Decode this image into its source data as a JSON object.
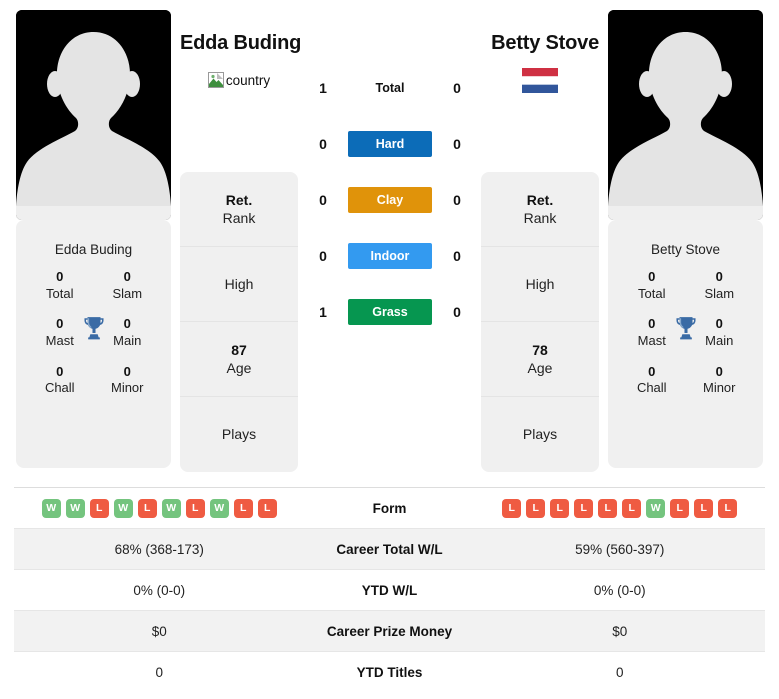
{
  "players": {
    "left": {
      "name": "Edda Buding",
      "card_name": "Edda Buding",
      "country_icon": "broken-image-icon",
      "country_alt": "country",
      "titles": [
        {
          "num": "0",
          "label": "Total"
        },
        {
          "num": "0",
          "label": "Slam"
        },
        {
          "num": "0",
          "label": "Mast"
        },
        {
          "num": "0",
          "label": "Main"
        },
        {
          "num": "0",
          "label": "Chall"
        },
        {
          "num": "0",
          "label": "Minor"
        }
      ],
      "trophy_icon": "trophy-icon",
      "info": [
        {
          "value": "Ret.",
          "label": "Rank"
        },
        {
          "value": "",
          "label": "High"
        },
        {
          "value": "87",
          "label": "Age"
        },
        {
          "value": "",
          "label": "Plays"
        }
      ]
    },
    "right": {
      "name": "Betty Stove",
      "card_name": "Betty Stove",
      "country_icon": "netherlands-flag-icon",
      "country_alt": "Netherlands",
      "titles": [
        {
          "num": "0",
          "label": "Total"
        },
        {
          "num": "0",
          "label": "Slam"
        },
        {
          "num": "0",
          "label": "Mast"
        },
        {
          "num": "0",
          "label": "Main"
        },
        {
          "num": "0",
          "label": "Chall"
        },
        {
          "num": "0",
          "label": "Minor"
        }
      ],
      "trophy_icon": "trophy-icon",
      "info": [
        {
          "value": "Ret.",
          "label": "Rank"
        },
        {
          "value": "",
          "label": "High"
        },
        {
          "value": "78",
          "label": "Age"
        },
        {
          "value": "",
          "label": "Plays"
        }
      ]
    }
  },
  "head_to_head": [
    {
      "label": "Total",
      "left": "1",
      "right": "0",
      "badge": false,
      "color": ""
    },
    {
      "label": "Hard",
      "left": "0",
      "right": "0",
      "badge": true,
      "color": "#0c6cb8"
    },
    {
      "label": "Clay",
      "left": "0",
      "right": "0",
      "badge": true,
      "color": "#e0930a"
    },
    {
      "label": "Indoor",
      "left": "0",
      "right": "0",
      "badge": true,
      "color": "#339af0"
    },
    {
      "label": "Grass",
      "left": "1",
      "right": "0",
      "badge": true,
      "color": "#069650"
    }
  ],
  "stats_table": {
    "form_label": "Form",
    "form_left": [
      "W",
      "W",
      "L",
      "W",
      "L",
      "W",
      "L",
      "W",
      "L",
      "L"
    ],
    "form_right": [
      "L",
      "L",
      "L",
      "L",
      "L",
      "L",
      "W",
      "L",
      "L",
      "L"
    ],
    "rows": [
      {
        "label": "Career Total W/L",
        "left": "68% (368-173)",
        "right": "59% (560-397)"
      },
      {
        "label": "YTD W/L",
        "left": "0% (0-0)",
        "right": "0% (0-0)"
      },
      {
        "label": "Career Prize Money",
        "left": "$0",
        "right": "$0"
      },
      {
        "label": "YTD Titles",
        "left": "0",
        "right": "0"
      }
    ]
  },
  "colors": {
    "hard": "#0c6cb8",
    "clay": "#e0930a",
    "indoor": "#339af0",
    "grass": "#069650",
    "win": "#74c47e",
    "loss": "#ef5b42",
    "trophy": "#3a6ba5"
  }
}
